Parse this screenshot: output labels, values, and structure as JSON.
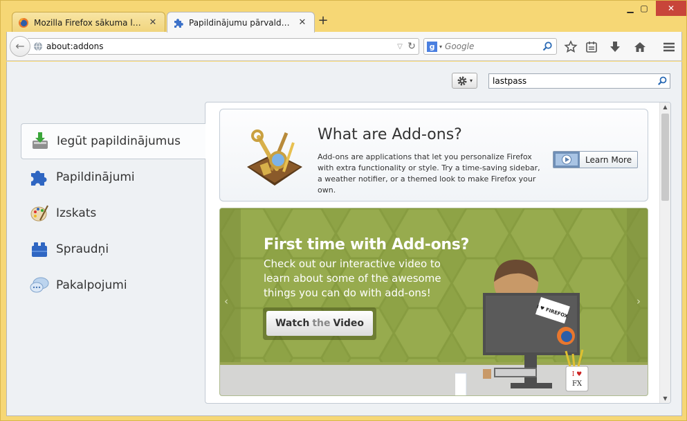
{
  "window": {
    "min_label": "▁",
    "max_label": "▢",
    "close_label": "✕"
  },
  "tabs": [
    {
      "label": "Mozilla Firefox sākuma lapa",
      "icon": "firefox-icon",
      "active": false
    },
    {
      "label": "Papildinājumu pārvaldnieks",
      "icon": "puzzle-icon",
      "active": true
    }
  ],
  "tab_close_label": "✕",
  "new_tab_label": "+",
  "navbar": {
    "back_label": "←",
    "url": "about:addons",
    "url_drop": "▽",
    "reload_label": "↻",
    "search_engine": "g",
    "search_drop": "▾",
    "search_placeholder": "Google"
  },
  "toolbar_icons": [
    "star-icon",
    "bookmarks-list-icon",
    "download-icon",
    "home-icon",
    "menu-icon"
  ],
  "addons": {
    "search_value": "lastpass",
    "gear_drop": "▾",
    "categories": [
      {
        "label": "Iegūt papildinājumus",
        "icon": "get-addons-icon",
        "selected": true
      },
      {
        "label": "Papildinājumi",
        "icon": "extensions-icon",
        "selected": false
      },
      {
        "label": "Izskats",
        "icon": "appearance-icon",
        "selected": false
      },
      {
        "label": "Spraudņi",
        "icon": "plugins-icon",
        "selected": false
      },
      {
        "label": "Pakalpojumi",
        "icon": "services-icon",
        "selected": false
      }
    ],
    "intro": {
      "title": "What are Add-ons?",
      "description": "Add-ons are applications that let you personalize Firefox with extra functionality or style. Try a time-saving sidebar, a weather notifier, or a themed look to make Firefox your own.",
      "learn_more": "Learn More"
    },
    "promo": {
      "title": "First time with Add-ons?",
      "description": "Check out our interactive video to learn about some of the awesome things you can do with add-ons!",
      "watch_1": "Watch",
      "watch_2": "the",
      "watch_3": "Video",
      "prev_label": "‹",
      "next_label": "›",
      "sticker_text": "I ♥ FIREFOX",
      "mug_text_1": "I ♥",
      "mug_text_2": "FX"
    },
    "scroll_up": "▲",
    "scroll_down": "▼"
  }
}
